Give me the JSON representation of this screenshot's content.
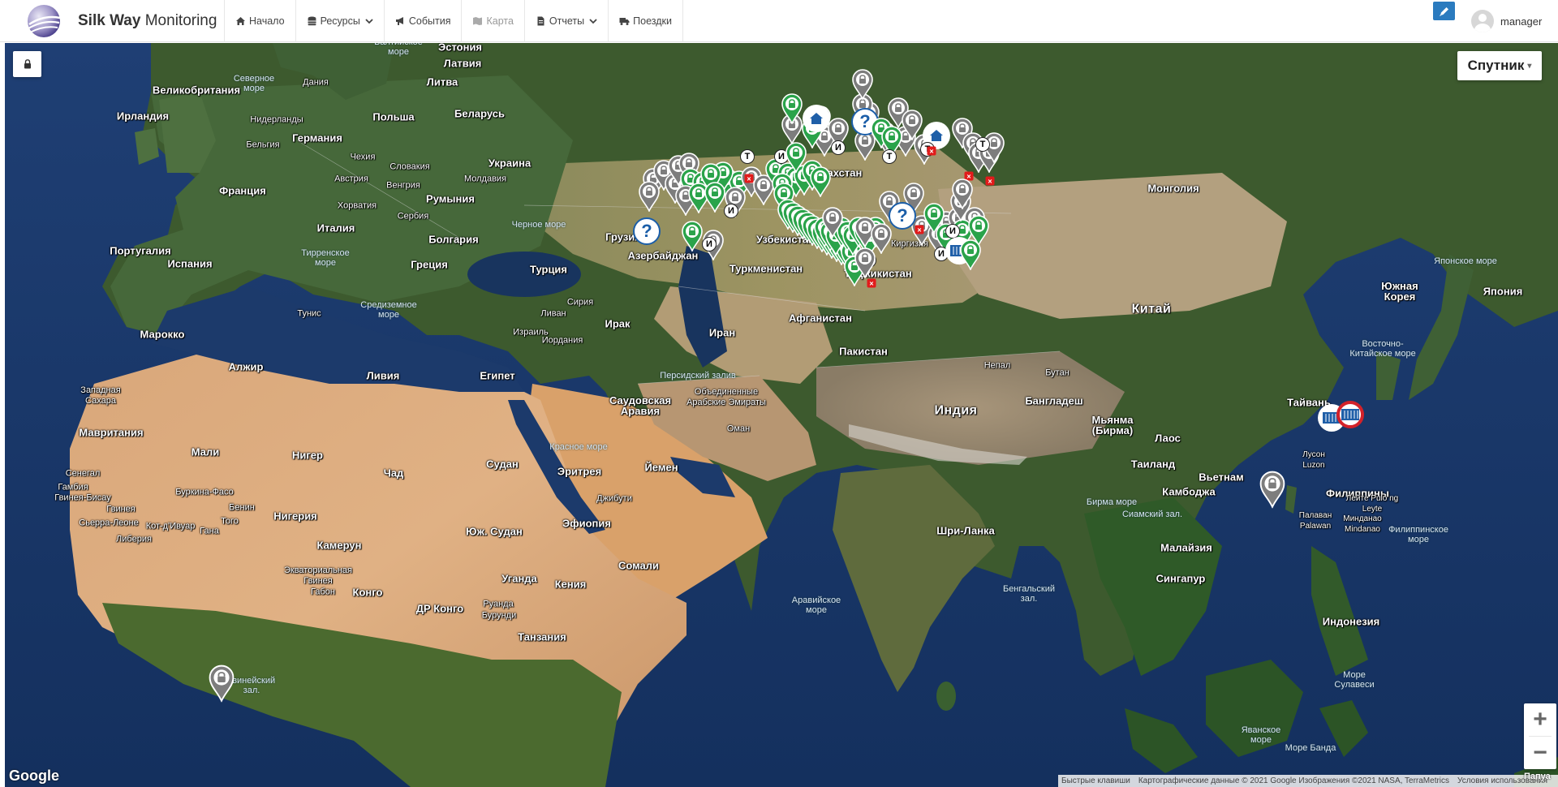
{
  "brand": {
    "title_bold": "Silk Way",
    "title_rest": " Monitoring"
  },
  "nav": [
    {
      "label": "Начало",
      "icon": "home-icon",
      "dropdown": false,
      "disabled": false
    },
    {
      "label": "Ресурсы",
      "icon": "database-icon",
      "dropdown": true,
      "disabled": false
    },
    {
      "label": "События",
      "icon": "bullhorn-icon",
      "dropdown": false,
      "disabled": false
    },
    {
      "label": "Карта",
      "icon": "map-icon",
      "dropdown": false,
      "disabled": true
    },
    {
      "label": "Отчеты",
      "icon": "file-icon",
      "dropdown": true,
      "disabled": false
    },
    {
      "label": "Поездки",
      "icon": "truck-icon",
      "dropdown": false,
      "disabled": false
    }
  ],
  "user": {
    "name": "manager"
  },
  "map": {
    "map_type_label": "Спутник",
    "google_logo": "Google",
    "attribution": [
      "Быстрые клавиши",
      "Картографические данные © 2021 Google Изображения ©2021 NASA, TerraMetrics",
      "Условия использования"
    ],
    "zoom_in": "+",
    "zoom_out": "−",
    "edge_label": "Папуа",
    "country_labels": [
      "Эстония",
      "Латвия",
      "Литва",
      "Беларусь",
      "Польша",
      "Германия",
      "Нидерланды",
      "Бельгия",
      "Дания",
      "Великобритания",
      "Ирландия",
      "Франция",
      "Чехия",
      "Словакия",
      "Австрия",
      "Венгрия",
      "Хорватия",
      "Сербия",
      "Румыния",
      "Молдавия",
      "Украина",
      "Италия",
      "Болгария",
      "Португалия",
      "Испания",
      "Греция",
      "Турция",
      "Грузия",
      "Азербайджан",
      "Казахстан",
      "Узбекистан",
      "Туркменистан",
      "Киргизия",
      "Таджикистан",
      "Монголия",
      "Китай",
      "Южная Корея",
      "Япония",
      "Тайвань",
      "Афганистан",
      "Пакистан",
      "Индия",
      "Непал",
      "Бутан",
      "Бангладеш",
      "Мьянма (Бирма)",
      "Лаос",
      "Таиланд",
      "Вьетнам",
      "Камбоджа",
      "Филиппины",
      "Малайзия",
      "Сингапур",
      "Индонезия",
      "Шри-Ланка",
      "Иран",
      "Ирак",
      "Сирия",
      "Ливан",
      "Израиль",
      "Иордания",
      "Саудовская Аравия",
      "Объединенные Арабские Эмираты",
      "Оман",
      "Йемен",
      "Египет",
      "Ливия",
      "Тунис",
      "Алжир",
      "Марокко",
      "Западная Сахара",
      "Мавритания",
      "Мали",
      "Нигер",
      "Чад",
      "Судан",
      "Эритрея",
      "Джибути",
      "Эфиопия",
      "Сомали",
      "Юж. Судан",
      "Уганда",
      "Кения",
      "Руанда",
      "Бурунди",
      "Танзания",
      "ДР Конго",
      "Конго",
      "Габон",
      "Экваториальная Гвинея",
      "Камерун",
      "Нигерия",
      "Бенин",
      "Того",
      "Гана",
      "Буркина-Фасо",
      "Кот-д'Ивуар",
      "Либерия",
      "Сьерра-Леоне",
      "Гвинея",
      "Гвинея-Бисау",
      "Гамбия",
      "Сенегал",
      "Палаван Palawan",
      "Лейте Pulo ng Leyte",
      "Минданао Mindanao",
      "Лусон Luzon"
    ],
    "sea_labels": [
      "Балтийское море",
      "Северное море",
      "Черное море",
      "Тирренское море",
      "Средиземное море",
      "Персидский залив",
      "Красное море",
      "Аравийское море",
      "Бенгальский зал.",
      "Сиамский зал.",
      "Бирма море",
      "Филиппинское море",
      "Восточно-Китайское море",
      "Японское море",
      "Море Сулавеси",
      "Яванское море",
      "Море Банда",
      "Гвинейский зал."
    ],
    "marker_badges": [
      "Т",
      "И"
    ],
    "unknown_marker": "?"
  }
}
